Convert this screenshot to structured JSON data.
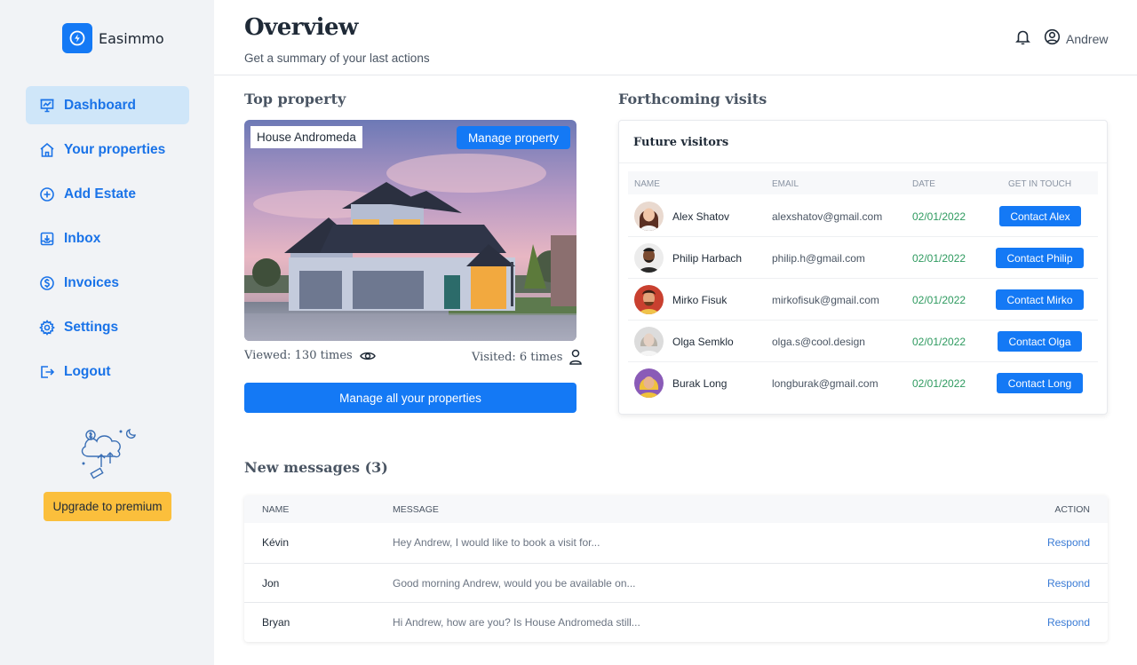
{
  "app": {
    "name": "Easimmo"
  },
  "sidebar": {
    "items": [
      {
        "label": "Dashboard",
        "icon": "presentation-chart-icon",
        "active": true
      },
      {
        "label": "Your properties",
        "icon": "home-icon"
      },
      {
        "label": "Add Estate",
        "icon": "plus-circle-icon"
      },
      {
        "label": "Inbox",
        "icon": "inbox-download-icon"
      },
      {
        "label": "Invoices",
        "icon": "dollar-circle-icon"
      },
      {
        "label": "Settings",
        "icon": "gear-icon"
      },
      {
        "label": "Logout",
        "icon": "logout-icon"
      }
    ],
    "upgrade_label": "Upgrade to premium"
  },
  "header": {
    "title": "Overview",
    "subtitle": "Get a summary of your last actions",
    "user_name": "Andrew"
  },
  "top_property": {
    "section_title": "Top property",
    "name": "House Andromeda",
    "manage_label": "Manage property",
    "viewed": "Viewed: 130 times",
    "visited": "Visited: 6 times",
    "manage_all_label": "Manage all your properties"
  },
  "visits": {
    "section_title": "Forthcoming visits",
    "card_title": "Future visitors",
    "columns": {
      "name": "Name",
      "email": "Email",
      "date": "Date",
      "contact": "Get in touch"
    },
    "rows": [
      {
        "name": "Alex Shatov",
        "email": "alexshatov@gmail.com",
        "date": "02/01/2022",
        "contact": "Contact Alex"
      },
      {
        "name": "Philip Harbach",
        "email": "philip.h@gmail.com",
        "date": "02/01/2022",
        "contact": "Contact Philip"
      },
      {
        "name": "Mirko Fisuk",
        "email": "mirkofisuk@gmail.com",
        "date": "02/01/2022",
        "contact": "Contact Mirko"
      },
      {
        "name": "Olga Semklo",
        "email": "olga.s@cool.design",
        "date": "02/01/2022",
        "contact": "Contact Olga"
      },
      {
        "name": "Burak Long",
        "email": "longburak@gmail.com",
        "date": "02/01/2022",
        "contact": "Contact Long"
      }
    ]
  },
  "messages": {
    "section_title": "New messages (3)",
    "columns": {
      "name": "Name",
      "message": "Message",
      "action": "Action"
    },
    "rows": [
      {
        "name": "Kévin",
        "message": "Hey Andrew, I would like to book a visit for...",
        "action": "Respond"
      },
      {
        "name": "Jon",
        "message": "Good morning Andrew, would you be available on...",
        "action": "Respond"
      },
      {
        "name": "Bryan",
        "message": "Hi Andrew, how are you? Is House Andromeda still...",
        "action": "Respond"
      }
    ]
  },
  "colors": {
    "accent": "#1479f5",
    "sidebar_bg": "#f1f3f6",
    "active_nav_bg": "#cfe6f9",
    "upgrade": "#fbbf3c",
    "date_green": "#2e9a5f"
  }
}
